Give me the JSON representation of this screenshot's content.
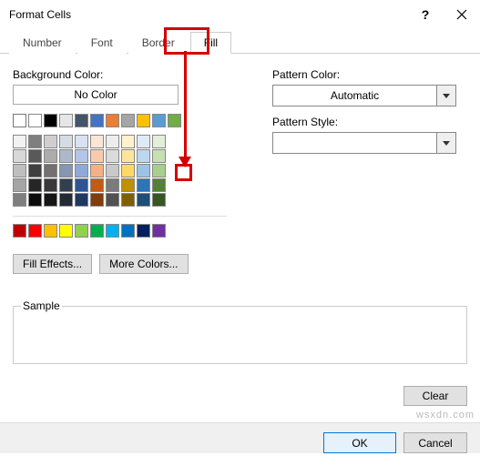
{
  "window": {
    "title": "Format Cells",
    "help": "?",
    "close": "×"
  },
  "tabs": {
    "number": "Number",
    "font": "Font",
    "border": "Border",
    "fill": "Fill"
  },
  "fill": {
    "bg_label": "Background Color:",
    "no_color": "No Color",
    "fill_effects": "Fill Effects...",
    "more_colors": "More Colors...",
    "pattern_color_label": "Pattern Color:",
    "pattern_color_value": "Automatic",
    "pattern_style_label": "Pattern Style:"
  },
  "sample_label": "Sample",
  "clear": "Clear",
  "ok": "OK",
  "cancel": "Cancel",
  "watermark": "wsxdn.com",
  "palette": {
    "theme_row": [
      "#ffffff",
      "#000000",
      "#e7e6e6",
      "#44546a",
      "#4472c4",
      "#ed7d31",
      "#a5a5a5",
      "#ffc000",
      "#5b9bd5",
      "#70ad47"
    ],
    "tints": [
      [
        "#f2f2f2",
        "#7f7f7f",
        "#d0cece",
        "#d6dce4",
        "#d9e2f3",
        "#fbe5d5",
        "#ededed",
        "#fff2cc",
        "#deebf6",
        "#e2efd9"
      ],
      [
        "#d8d8d8",
        "#595959",
        "#aeabab",
        "#adb9ca",
        "#b4c6e7",
        "#f7cbac",
        "#dbdbdb",
        "#fee599",
        "#bdd7ee",
        "#c5e0b3"
      ],
      [
        "#bfbfbf",
        "#3f3f3f",
        "#757070",
        "#8496b0",
        "#8eaadb",
        "#f4b183",
        "#c9c9c9",
        "#ffd965",
        "#9cc3e5",
        "#a8d08d"
      ],
      [
        "#a5a5a5",
        "#262626",
        "#3a3838",
        "#323f4f",
        "#2f5496",
        "#c55a11",
        "#7b7b7b",
        "#bf9000",
        "#2e75b5",
        "#538135"
      ],
      [
        "#7f7f7f",
        "#0c0c0c",
        "#171616",
        "#222a35",
        "#1f3864",
        "#833c0b",
        "#525252",
        "#7f6000",
        "#1e4e79",
        "#375623"
      ]
    ],
    "standard": [
      "#c00000",
      "#ff0000",
      "#ffc000",
      "#ffff00",
      "#92d050",
      "#00b050",
      "#00b0f0",
      "#0070c0",
      "#002060",
      "#7030a0"
    ]
  }
}
